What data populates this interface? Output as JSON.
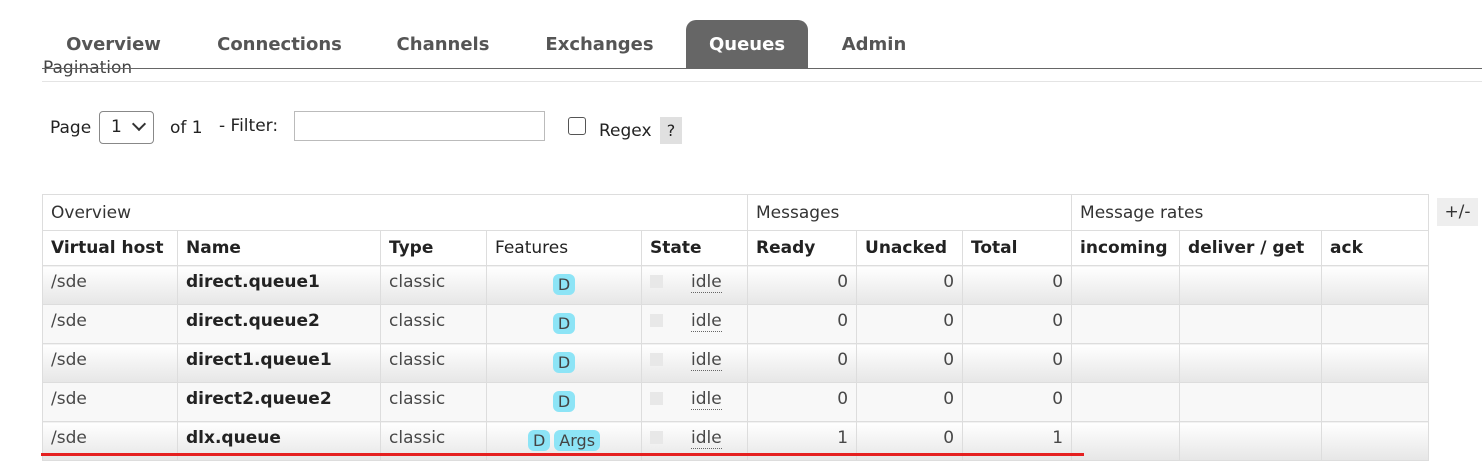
{
  "tabs": [
    {
      "label": "Overview",
      "active": false
    },
    {
      "label": "Connections",
      "active": false
    },
    {
      "label": "Channels",
      "active": false
    },
    {
      "label": "Exchanges",
      "active": false
    },
    {
      "label": "Queues",
      "active": true
    },
    {
      "label": "Admin",
      "active": false
    }
  ],
  "pagination": {
    "legend": "Pagination",
    "page_label": "Page",
    "page_value": "1",
    "of_label": "of 1",
    "filter_label": "- Filter:",
    "filter_value": "",
    "regex_label": "Regex",
    "regex_checked": false,
    "help_label": "?"
  },
  "table": {
    "groups": [
      "Overview",
      "Messages",
      "Message rates"
    ],
    "toggle_label": "+/-",
    "columns": [
      "Virtual host",
      "Name",
      "Type",
      "Features",
      "State",
      "Ready",
      "Unacked",
      "Total",
      "incoming",
      "deliver / get",
      "ack"
    ],
    "rows": [
      {
        "vhost": "/sde",
        "name": "direct.queue1",
        "type": "classic",
        "features": [
          "D"
        ],
        "state": "idle",
        "ready": "0",
        "unacked": "0",
        "total": "0"
      },
      {
        "vhost": "/sde",
        "name": "direct.queue2",
        "type": "classic",
        "features": [
          "D"
        ],
        "state": "idle",
        "ready": "0",
        "unacked": "0",
        "total": "0"
      },
      {
        "vhost": "/sde",
        "name": "direct1.queue1",
        "type": "classic",
        "features": [
          "D"
        ],
        "state": "idle",
        "ready": "0",
        "unacked": "0",
        "total": "0"
      },
      {
        "vhost": "/sde",
        "name": "direct2.queue2",
        "type": "classic",
        "features": [
          "D"
        ],
        "state": "idle",
        "ready": "0",
        "unacked": "0",
        "total": "0"
      },
      {
        "vhost": "/sde",
        "name": "dlx.queue",
        "type": "classic",
        "features": [
          "D",
          "Args"
        ],
        "state": "idle",
        "ready": "1",
        "unacked": "0",
        "total": "1"
      }
    ]
  },
  "colors": {
    "active_tab": "#666666",
    "feature_badge": "#8de4f6",
    "annotation_line": "#e52020"
  }
}
